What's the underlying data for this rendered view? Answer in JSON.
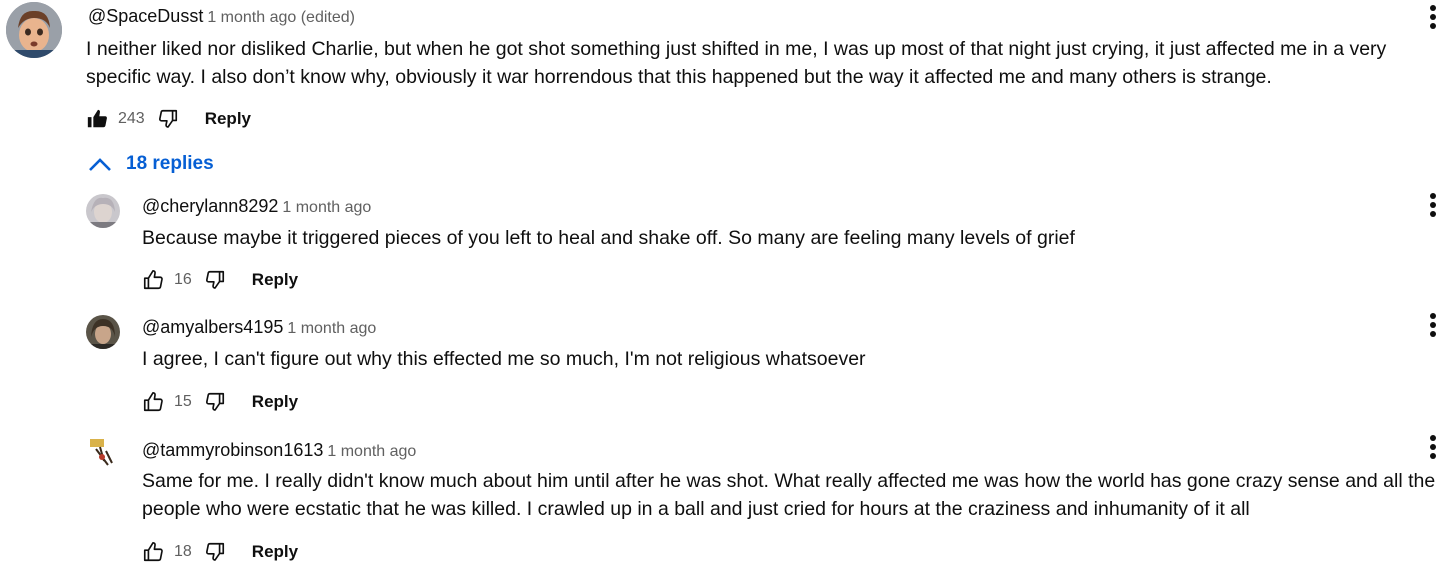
{
  "main_comment": {
    "author": "@SpaceDusst",
    "time": "1 month ago (edited)",
    "line1": "I neither liked nor disliked Charlie, but when he got shot something just shifted in me, I was up most of that night just crying, it just affected me in a very",
    "line2": "specific way. I also don’t know why, obviously it war horrendous that this happened but the way it affected me and many others is strange.",
    "likes": "243",
    "reply_label": "Reply",
    "liked": true
  },
  "replies_toggle": {
    "label": "18 replies",
    "icon": "chevron-up-icon",
    "color": "#065fd4"
  },
  "replies": [
    {
      "author": "@cherylann8292",
      "time": "1 month ago",
      "line1": "Because maybe it triggered pieces of you left to heal and shake off. So many are feeling many levels of grief",
      "likes": "16",
      "reply_label": "Reply"
    },
    {
      "author": "@amyalbers4195",
      "time": "1 month ago",
      "line1": "I agree, I can't figure out why this effected me so much, I'm not religious whatsoever",
      "likes": "15",
      "reply_label": "Reply"
    },
    {
      "author": "@tammyrobinson1613",
      "time": "1 month ago",
      "line1": "Same for me. I really didn't know much about him until after he was shot. What really affected me was how the world has gone crazy sense and all the",
      "line2": "people who were ecstatic that he was killed. I crawled up in a ball and just cried for hours at the craziness and inhumanity of it all",
      "likes": "18",
      "reply_label": "Reply"
    }
  ],
  "icons": {
    "like": "thumbs-up-icon",
    "dislike": "thumbs-down-icon",
    "menu": "more-vertical-icon"
  }
}
